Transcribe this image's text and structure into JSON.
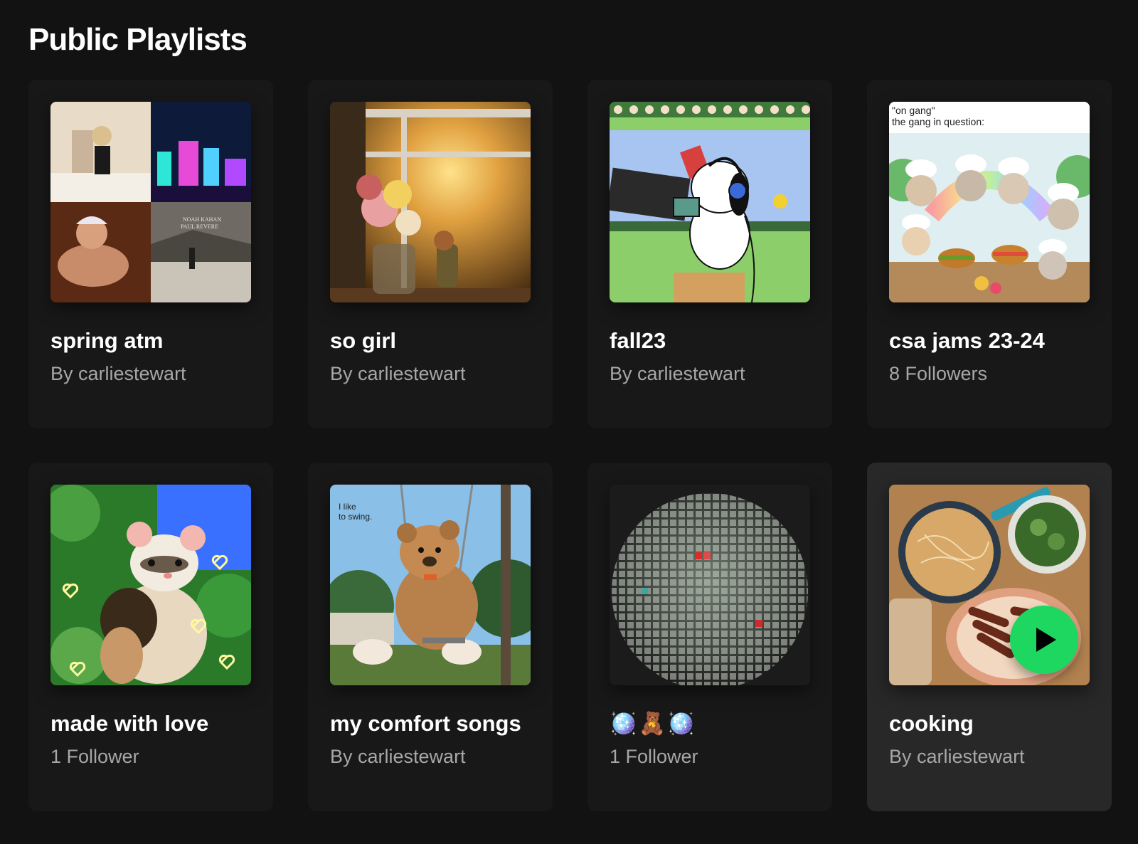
{
  "section": {
    "title": "Public Playlists"
  },
  "playlists": [
    {
      "title": "spring atm",
      "subtitle": "By carliestewart",
      "cover": "four-album-collage"
    },
    {
      "title": "so girl",
      "subtitle": "By carliestewart",
      "cover": "sunset-window-flowers"
    },
    {
      "title": "fall23",
      "subtitle": "By carliestewart",
      "cover": "snoopy-headphones"
    },
    {
      "title": "csa jams 23-24",
      "subtitle": "8 Followers",
      "cover": "chef-kittens-meme",
      "cover_text": [
        "\"on gang\"",
        "the gang in question:"
      ]
    },
    {
      "title": "made with love",
      "subtitle": "1 Follower",
      "cover": "ferret-hearts"
    },
    {
      "title": "my comfort songs",
      "subtitle": "By carliestewart",
      "cover": "teddy-bear-swing",
      "cover_text": [
        "I like",
        "to swing."
      ]
    },
    {
      "title": "🪩🧸🪩",
      "subtitle": "1 Follower",
      "cover": "disco-ball"
    },
    {
      "title": "cooking",
      "subtitle": "By carliestewart",
      "cover": "pasta-and-sausages",
      "hovered": true
    }
  ],
  "play_button": {
    "icon": "play-icon",
    "color": "#1ed760"
  },
  "colors": {
    "background": "#121212",
    "card": "#181818",
    "card_hover": "#282828",
    "subtitle": "#a7a7a7",
    "accent": "#1ed760"
  }
}
